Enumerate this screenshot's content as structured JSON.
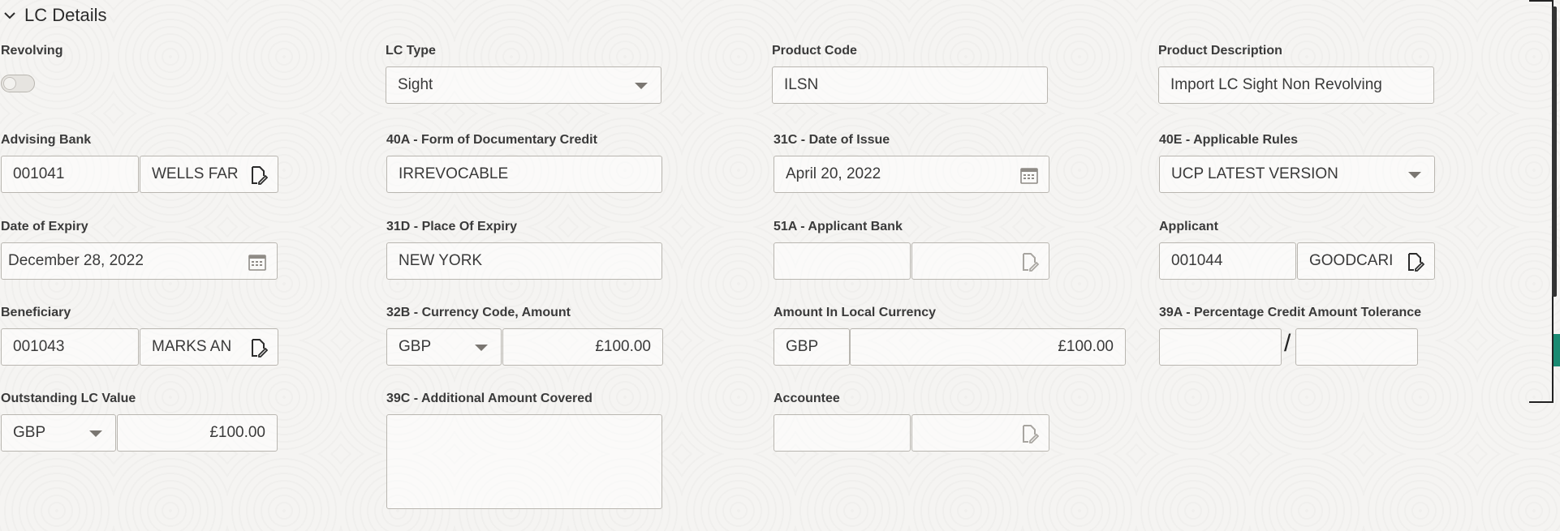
{
  "section": {
    "title": "LC Details"
  },
  "fields": {
    "revolving": {
      "label": "Revolving",
      "state": "off"
    },
    "lc_type": {
      "label": "LC Type",
      "value": "Sight"
    },
    "product_code": {
      "label": "Product Code",
      "value": "ILSN"
    },
    "product_description": {
      "label": "Product Description",
      "value": "Import LC Sight Non Revolving"
    },
    "advising_bank": {
      "label": "Advising Bank",
      "code": "001041",
      "name": "WELLS FAR"
    },
    "form_of_credit": {
      "label": "40A - Form of Documentary Credit",
      "value": "IRREVOCABLE"
    },
    "date_of_issue": {
      "label": "31C - Date of Issue",
      "value": "April 20, 2022"
    },
    "applicable_rules": {
      "label": "40E - Applicable Rules",
      "value": "UCP LATEST VERSION"
    },
    "date_of_expiry": {
      "label": "Date of Expiry",
      "value": "December 28, 2022"
    },
    "place_of_expiry": {
      "label": "31D - Place Of Expiry",
      "value": "NEW YORK"
    },
    "applicant_bank": {
      "label": "51A - Applicant Bank",
      "code": "",
      "name": ""
    },
    "applicant": {
      "label": "Applicant",
      "code": "001044",
      "name": "GOODCARI"
    },
    "beneficiary": {
      "label": "Beneficiary",
      "code": "001043",
      "name": "MARKS AN"
    },
    "currency_amount": {
      "label": "32B - Currency Code, Amount",
      "currency": "GBP",
      "amount": "£100.00"
    },
    "local_currency": {
      "label": "Amount In Local Currency",
      "currency": "GBP",
      "amount": "£100.00"
    },
    "tolerance": {
      "label": "39A - Percentage Credit Amount Tolerance",
      "separator": "/",
      "plus": "",
      "minus": ""
    },
    "outstanding_value": {
      "label": "Outstanding LC Value",
      "currency": "GBP",
      "amount": "£100.00"
    },
    "additional_amount": {
      "label": "39C - Additional Amount Covered",
      "value": ""
    },
    "accountee": {
      "label": "Accountee",
      "code": "",
      "name": ""
    }
  },
  "icons": {
    "section_toggle": "chevron-down-icon",
    "lookup": "document-edit-icon",
    "calendar": "calendar-icon",
    "dropdown": "caret-down-icon"
  },
  "colors": {
    "border": "#b9b6b0",
    "text": "#2b2b2b",
    "icon": "#4a4a4a",
    "disabled_icon": "#a8a5a0",
    "accent": "#1a8a72"
  }
}
